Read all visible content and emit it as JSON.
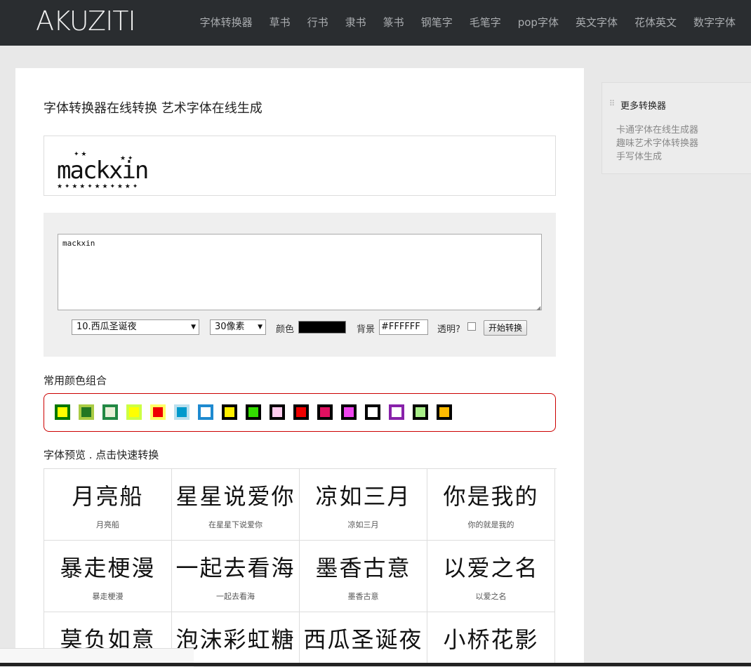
{
  "site": {
    "logo": "AKUZITI"
  },
  "nav": [
    "字体转换器",
    "草书",
    "行书",
    "隶书",
    "篆书",
    "钢笔字",
    "毛笔字",
    "pop字体",
    "英文字体",
    "花体英文",
    "数字字体"
  ],
  "main": {
    "title": "字体转换器在线转换 艺术字体在线生成",
    "preview_text": "mackxin",
    "textarea_value": "mackxin",
    "font_select": "10.西瓜圣诞夜",
    "size_select": "30像素",
    "color_label": "颜色",
    "color_value": "#000000",
    "bg_label": "背景",
    "bg_value": "#FFFFFF",
    "transparent_label": "透明?",
    "convert_button": "开始转换",
    "color_combos_label": "常用颜色组合",
    "swatches": [
      {
        "border": "#007700",
        "fill": "#ffff00"
      },
      {
        "border": "#aacc44",
        "fill": "#227722"
      },
      {
        "border": "#228844",
        "fill": "#e8f0d8"
      },
      {
        "border": "#ccff44",
        "fill": "#ffff00"
      },
      {
        "border": "#ffff66",
        "fill": "#ee0000"
      },
      {
        "border": "#bbe0ee",
        "fill": "#0099cc"
      },
      {
        "border": "#1e8ad0",
        "fill": "#ffffff"
      },
      {
        "border": "#000000",
        "fill": "#ffee00"
      },
      {
        "border": "#000000",
        "fill": "#33dd00"
      },
      {
        "border": "#000000",
        "fill": "#ffccee"
      },
      {
        "border": "#000000",
        "fill": "#ee0000"
      },
      {
        "border": "#000000",
        "fill": "#e01060"
      },
      {
        "border": "#000000",
        "fill": "#ee44ee"
      },
      {
        "border": "#000000",
        "fill": "#ffffff"
      },
      {
        "border": "#8822aa",
        "fill": "#ffffff"
      },
      {
        "border": "#000000",
        "fill": "#a8ee88"
      },
      {
        "border": "#000000",
        "fill": "#ffbb00"
      }
    ],
    "font_preview_label": "字体预览 . 点击快速转换",
    "fonts": [
      {
        "art": "月亮船",
        "caption": "月亮船"
      },
      {
        "art": "星星说爱你",
        "caption": "在星星下说爱你"
      },
      {
        "art": "凉如三月",
        "caption": "凉如三月"
      },
      {
        "art": "你是我的",
        "caption": "你的就是我的"
      },
      {
        "art": "暴走梗漫",
        "caption": "暴走梗漫"
      },
      {
        "art": "一起去看海",
        "caption": "一起去看海"
      },
      {
        "art": "墨香古意",
        "caption": "墨香古意"
      },
      {
        "art": "以爱之名",
        "caption": "以爱之名"
      },
      {
        "art": "莫负如意",
        "caption": ""
      },
      {
        "art": "泡沫彩虹糖",
        "caption": ""
      },
      {
        "art": "西瓜圣诞夜",
        "caption": ""
      },
      {
        "art": "小桥花影",
        "caption": ""
      }
    ]
  },
  "sidebar": {
    "title": "更多转换器",
    "links": [
      "卡通字体在线生成器",
      "趣味艺术字体转换器",
      "手写体生成"
    ]
  }
}
